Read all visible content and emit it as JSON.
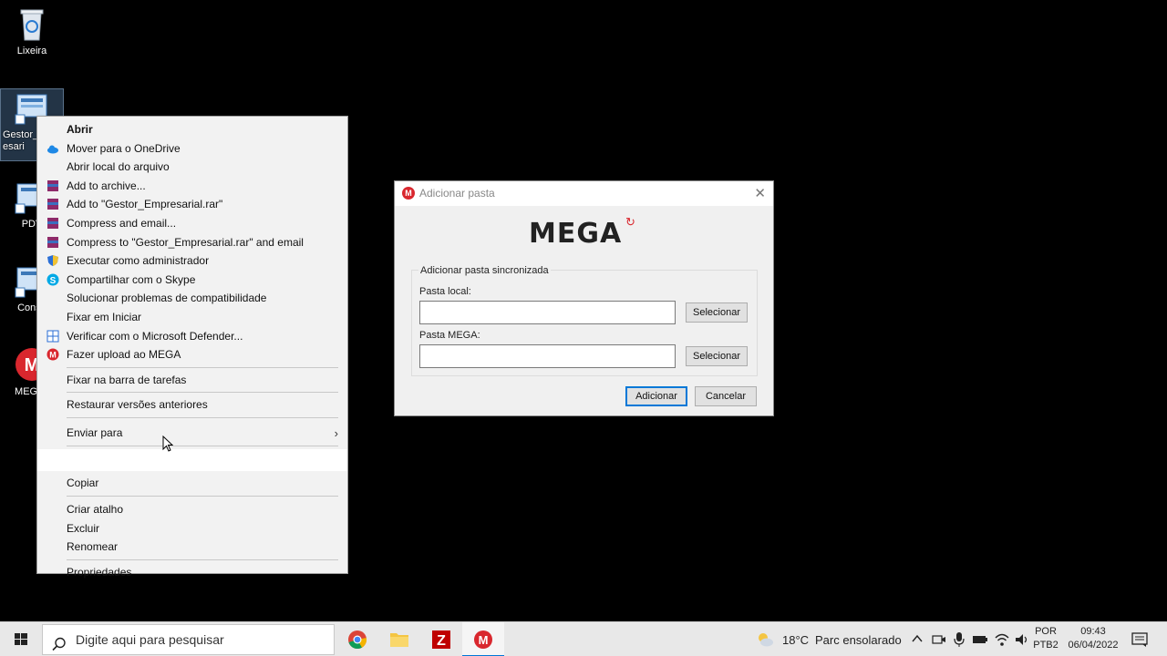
{
  "desktop": {
    "icons": [
      {
        "label": "Lixeira"
      },
      {
        "label": "Gestor_\nesari"
      },
      {
        "label": "PDV"
      },
      {
        "label": "Consu"
      },
      {
        "label": "MEGAs"
      }
    ]
  },
  "context_menu": {
    "items": [
      {
        "label": "Abrir"
      },
      {
        "label": "Mover para o OneDrive"
      },
      {
        "label": "Abrir local do arquivo"
      },
      {
        "label": "Add to archive..."
      },
      {
        "label": "Add to \"Gestor_Empresarial.rar\""
      },
      {
        "label": "Compress and email..."
      },
      {
        "label": "Compress to \"Gestor_Empresarial.rar\" and email"
      },
      {
        "label": "Executar como administrador"
      },
      {
        "label": "Compartilhar com o Skype"
      },
      {
        "label": "Solucionar problemas de compatibilidade"
      },
      {
        "label": "Fixar em Iniciar"
      },
      {
        "label": "Verificar com o Microsoft Defender..."
      },
      {
        "label": "Fazer upload ao MEGA"
      },
      {
        "label": "Fixar na barra de tarefas"
      },
      {
        "label": "Restaurar versões anteriores"
      },
      {
        "label": "Enviar para"
      },
      {
        "label": "Copiar"
      },
      {
        "label": "Criar atalho"
      },
      {
        "label": "Excluir"
      },
      {
        "label": "Renomear"
      },
      {
        "label": "Propriedades"
      }
    ]
  },
  "dialog": {
    "title": "Adicionar pasta",
    "brand": "MEGA",
    "group_title": "Adicionar pasta sincronizada",
    "local_label": "Pasta local:",
    "local_value": "",
    "mega_label": "Pasta MEGA:",
    "mega_value": "",
    "select_label": "Selecionar",
    "add_label": "Adicionar",
    "cancel_label": "Cancelar"
  },
  "taskbar": {
    "search_placeholder": "Digite aqui para pesquisar",
    "weather_temp": "18°C",
    "weather_text": "Parc ensolarado",
    "lang_top": "POR",
    "lang_bottom": "PTB2",
    "time": "09:43",
    "date": "06/04/2022"
  },
  "colors": {
    "mega_red": "#d9272e",
    "accent": "#0078d7"
  }
}
